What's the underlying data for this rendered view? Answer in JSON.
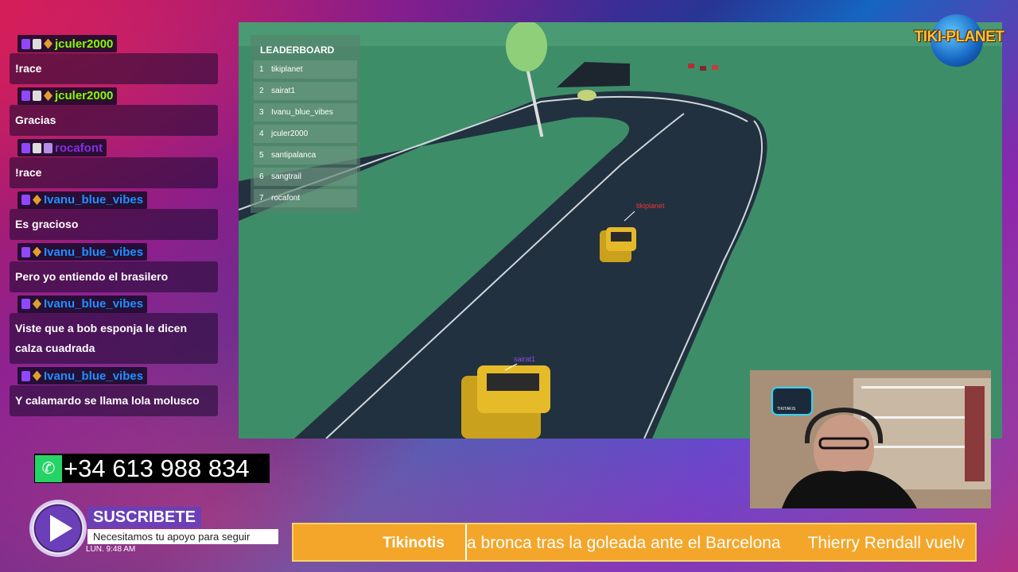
{
  "chat": {
    "messages": [
      {
        "user": "jculer2000",
        "user_color": "#7fff00",
        "text": "!race"
      },
      {
        "user": "jculer2000",
        "user_color": "#7fff00",
        "text": "Gracias"
      },
      {
        "user": "rocafont",
        "user_color": "#8a2be2",
        "text": "!race"
      },
      {
        "user": "Ivanu_blue_vibes",
        "user_color": "#1e90ff",
        "text": "Es gracioso"
      },
      {
        "user": "Ivanu_blue_vibes",
        "user_color": "#1e90ff",
        "text": "Pero yo entiendo el brasilero"
      },
      {
        "user": "Ivanu_blue_vibes",
        "user_color": "#1e90ff",
        "text": "Viste que a bob esponja le dicen calza cuadrada"
      },
      {
        "user": "Ivanu_blue_vibes",
        "user_color": "#1e90ff",
        "text": "Y calamardo se llama lola molusco"
      }
    ]
  },
  "game": {
    "leaderboard_title": "LEADERBOARD",
    "leaderboard": [
      {
        "rank": "1",
        "name": "tikiplanet"
      },
      {
        "rank": "2",
        "name": "sairat1"
      },
      {
        "rank": "3",
        "name": "Ivanu_blue_vibes"
      },
      {
        "rank": "4",
        "name": "jculer2000"
      },
      {
        "rank": "5",
        "name": "santipalanca"
      },
      {
        "rank": "6",
        "name": "sangtrail"
      },
      {
        "rank": "7",
        "name": "rocafont"
      }
    ],
    "car_labels": [
      {
        "name": "tikiplanet",
        "color": "#e53935"
      },
      {
        "name": "sairat1",
        "color": "#8a4de8"
      }
    ]
  },
  "logo": {
    "text": "TIKI-PLANET"
  },
  "webcam": {
    "sign_text": "TIKITAKIS"
  },
  "contact": {
    "icon": "whatsapp-icon",
    "phone": "+34 613 988 834"
  },
  "subscribe": {
    "title": "SUSCRIBETE",
    "message": "Necesitamos tu apoyo para seguir",
    "clock": "LUN. 9:48 AM"
  },
  "ticker": {
    "label": "Tikinotis",
    "headline_1": "a bronca tras la goleada ante el Barcelona",
    "headline_2": "Thierry Rendall vuelv"
  },
  "colors": {
    "accent_purple": "#6a3fb8",
    "ticker_orange": "#f4a62a",
    "whatsapp_green": "#25d366"
  }
}
